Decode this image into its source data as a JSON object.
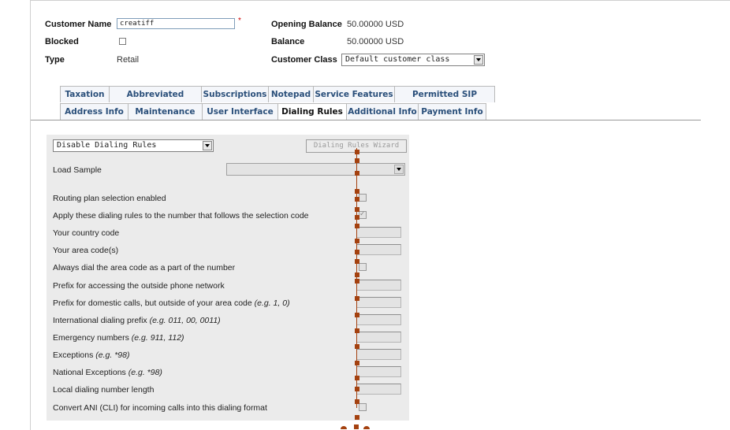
{
  "header": {
    "customer_name_label": "Customer Name",
    "customer_name_value": "creatiff",
    "required_mark": "*",
    "blocked_label": "Blocked",
    "type_label": "Type",
    "type_value": "Retail",
    "opening_balance_label": "Opening Balance",
    "opening_balance_value": "50.00000 USD",
    "balance_label": "Balance",
    "balance_value": "50.00000 USD",
    "customer_class_label": "Customer Class",
    "customer_class_value": "Default customer class"
  },
  "tabs_row1": [
    "Taxation",
    "Abbreviated Dialing",
    "Subscriptions",
    "Notepad",
    "Service Features",
    "Permitted SIP Proxies"
  ],
  "tabs_row2": [
    "Address Info",
    "Maintenance",
    "User Interface",
    "Dialing Rules",
    "Additional Info",
    "Payment Info"
  ],
  "active_tab": "Dialing Rules",
  "dialing": {
    "mode_select": "Disable Dialing Rules",
    "wizard_button": "Dialing Rules Wizard",
    "load_sample_label": "Load Sample",
    "rows": {
      "routing_plan": "Routing plan selection enabled",
      "apply_rules": "Apply these dialing rules to the number that follows the selection code",
      "country_code": "Your country code",
      "area_codes": "Your area code(s)",
      "always_dial_area": "Always dial the area code as a part of the number",
      "prefix_outside": "Prefix for accessing the outside phone network",
      "prefix_domestic": "Prefix for domestic calls, but outside of your area code ",
      "prefix_domestic_eg": "(e.g. 1, 0)",
      "intl_prefix": "International dialing prefix ",
      "intl_prefix_eg": "(e.g. 011, 00, 0011)",
      "emergency": "Emergency numbers ",
      "emergency_eg": "(e.g. 911, 112)",
      "exceptions": "Exceptions ",
      "exceptions_eg": "(e.g. *98)",
      "national_exceptions": "National Exceptions ",
      "national_exceptions_eg": "(e.g. *98)",
      "local_length": "Local dialing number length",
      "convert_ani": "Convert ANI (CLI) for incoming calls into this dialing format"
    }
  },
  "colors": {
    "tab_text": "#2a4f7a",
    "marker": "#a4410f",
    "panel_bg": "#ebebeb"
  }
}
